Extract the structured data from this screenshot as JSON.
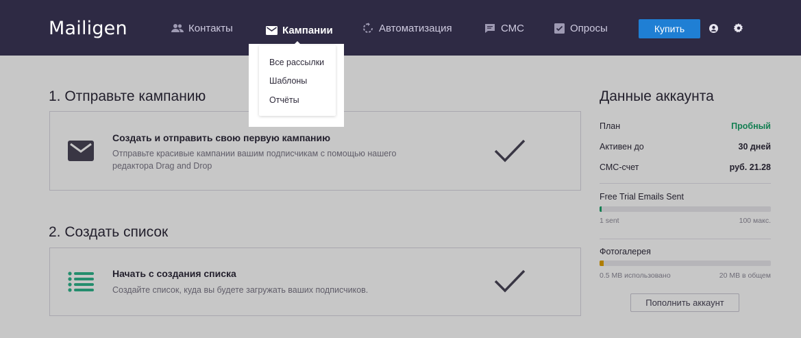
{
  "navbar": {
    "logo": "Mailigen",
    "items": [
      {
        "label": "Контакты",
        "icon": "contacts-icon"
      },
      {
        "label": "Кампании",
        "icon": "envelope-icon",
        "active": true
      },
      {
        "label": "Автоматизация",
        "icon": "automation-icon"
      },
      {
        "label": "СМС",
        "icon": "sms-icon"
      },
      {
        "label": "Опросы",
        "icon": "survey-icon"
      }
    ],
    "buy_label": "Купить",
    "user_icon": "user-icon",
    "settings_icon": "gear-icon"
  },
  "dropdown": {
    "items": [
      "Все рассылки",
      "Шаблоны",
      "Отчёты"
    ]
  },
  "steps": [
    {
      "title": "1. Отправьте кампанию",
      "card_title": "Создать и отправить свою первую кампанию",
      "card_desc": "Отправьте красивые кампании вашим подписчикам с помощью нашего редактора Drag and Drop",
      "icon": "envelope-icon"
    },
    {
      "title": "2. Создать список",
      "card_title": "Начать с создания списка",
      "card_desc": "Создайте список, куда вы будете загружать ваших подписчиков.",
      "icon": "list-icon"
    }
  ],
  "account": {
    "title": "Данные аккаунта",
    "rows": [
      {
        "label": "План",
        "value": "Пробный"
      },
      {
        "label": "Активен до",
        "value": "30 дней"
      },
      {
        "label": "СМС-счет",
        "value": "руб. 21.28"
      }
    ],
    "emails": {
      "label": "Free Trial Emails Sent",
      "used": "1 sent",
      "max": "100 макс.",
      "fraction": 0.01
    },
    "gallery": {
      "label": "Фотогалерея",
      "used": "0.5 MB использовано",
      "max": "20 MB в общем",
      "fraction": 0.025
    },
    "topup_label": "Пополнить аккаунт"
  },
  "colors": {
    "nav_bg": "#2e2a44",
    "accent_blue": "#1f7fd4",
    "green": "#1aa36a",
    "orange": "#e0a100",
    "list_icon": "#2fb58c"
  }
}
